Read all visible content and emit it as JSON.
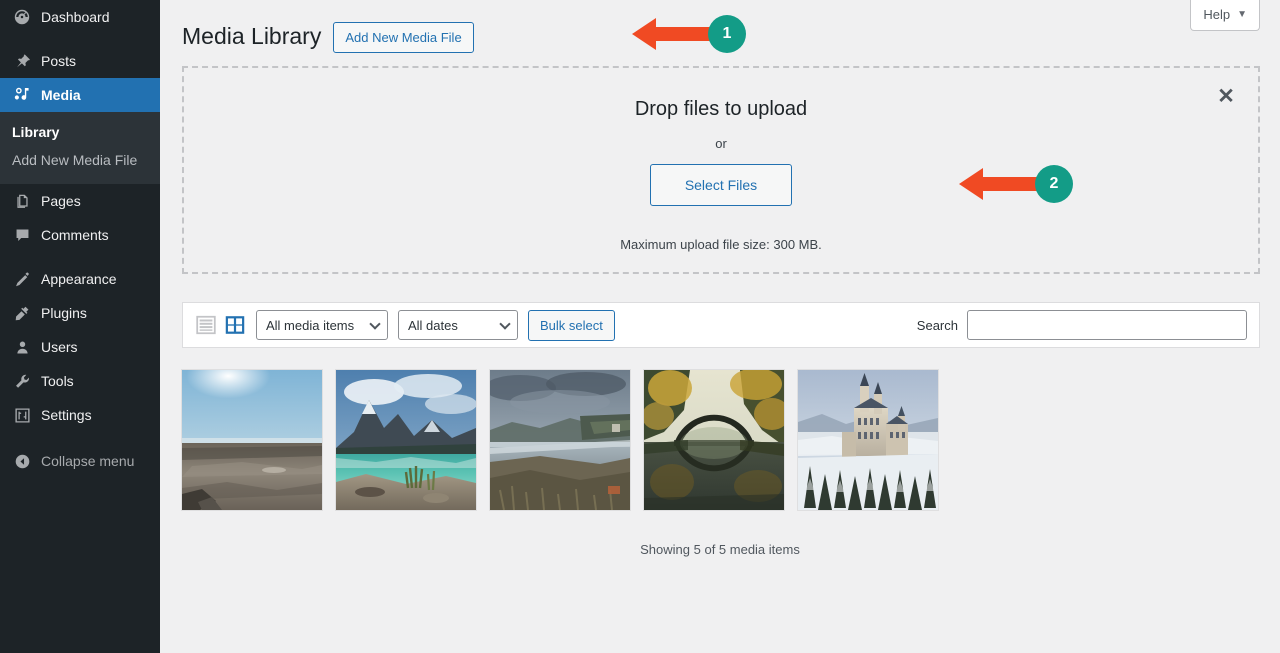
{
  "colors": {
    "admin_bg": "#1d2327",
    "submenu_bg": "#2c3338",
    "accent_blue": "#2271b1",
    "content_bg": "#f0f0f1",
    "annotation_arrow": "#f04a23",
    "annotation_badge": "#139c87"
  },
  "sidebar": {
    "items": [
      {
        "label": "Dashboard",
        "icon": "dashboard-icon",
        "current": false
      },
      {
        "label": "Posts",
        "icon": "pin-icon",
        "current": false
      },
      {
        "label": "Media",
        "icon": "media-icon",
        "current": true
      },
      {
        "label": "Pages",
        "icon": "pages-icon",
        "current": false
      },
      {
        "label": "Comments",
        "icon": "comments-icon",
        "current": false
      },
      {
        "label": "Appearance",
        "icon": "appearance-brush-icon",
        "current": false
      },
      {
        "label": "Plugins",
        "icon": "plugins-plug-icon",
        "current": false
      },
      {
        "label": "Users",
        "icon": "users-icon",
        "current": false
      },
      {
        "label": "Tools",
        "icon": "tools-wrench-icon",
        "current": false
      },
      {
        "label": "Settings",
        "icon": "settings-sliders-icon",
        "current": false
      }
    ],
    "submenu": [
      {
        "label": "Library",
        "current": true
      },
      {
        "label": "Add New Media File",
        "current": false
      }
    ],
    "collapse": {
      "label": "Collapse menu",
      "icon": "collapse-arrow-icon"
    }
  },
  "header": {
    "title": "Media Library",
    "add_new_label": "Add New Media File",
    "help_label": "Help",
    "help_caret": "▼"
  },
  "uploader": {
    "drop_title": "Drop files to upload",
    "or_text": "or",
    "select_files_label": "Select Files",
    "max_size_text": "Maximum upload file size: 300 MB.",
    "close_icon": "✕"
  },
  "toolbar": {
    "list_view_icon": "list-view-icon",
    "grid_view_icon": "grid-view-icon",
    "active_view": "grid",
    "media_type_filter": "All media items",
    "date_filter": "All dates",
    "bulk_select_label": "Bulk select",
    "search_label": "Search",
    "search_value": "",
    "search_placeholder": ""
  },
  "media": {
    "items": [
      {
        "name": "beach-shore-sunny",
        "alt": "Sunny beach shoreline with dark sand and rocks"
      },
      {
        "name": "mountain-lake-turquoise",
        "alt": "Turquoise mountain lake with snowy peak"
      },
      {
        "name": "foggy-bridge-valley",
        "alt": "Foggy river valley with a long bridge"
      },
      {
        "name": "autumn-arch-bridge",
        "alt": "Autumn stone arch bridge reflected in water"
      },
      {
        "name": "winter-castle",
        "alt": "Castle on a snowy hill in winter"
      }
    ],
    "count_text": "Showing 5 of 5 media items"
  },
  "annotations": [
    {
      "id": "1",
      "number": "1",
      "target": "add-new-media-file-button"
    },
    {
      "id": "2",
      "number": "2",
      "target": "select-files-button"
    }
  ]
}
